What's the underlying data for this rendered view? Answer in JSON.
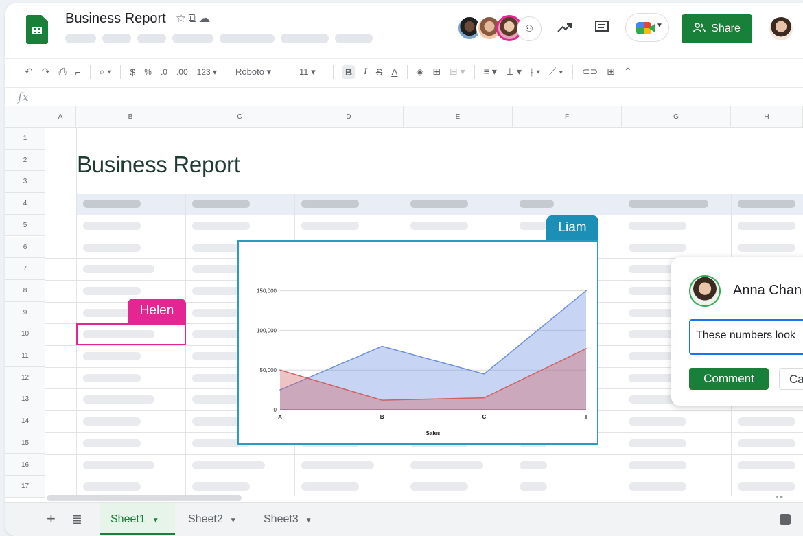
{
  "header": {
    "doc_title": "Business Report",
    "title_icons": [
      "star-icon",
      "move-to-folder-icon",
      "cloud-status-icon"
    ],
    "share_label": "Share",
    "collaborator_avatars": [
      "collaborator-avatar-1",
      "collaborator-avatar-2",
      "collaborator-avatar-3"
    ],
    "more_collaborators_icon": "person-chat-icon",
    "icons": [
      "activity-trend-icon",
      "comment-history-icon",
      "meet-icon",
      "user-avatar"
    ]
  },
  "toolbar": {
    "percent": "%",
    "currency": "$",
    "decimal_decrease": ".0",
    "decimal_increase": ".00",
    "number_format": "123",
    "font": "Roboto",
    "font_size": "11",
    "bold": "B",
    "italic": "I",
    "strike": "S",
    "text_color": "A"
  },
  "formula_bar": {
    "fx_label": "fx"
  },
  "grid": {
    "columns": [
      "A",
      "B",
      "C",
      "D",
      "E",
      "F",
      "G",
      "H"
    ],
    "rows": [
      "1",
      "2",
      "3",
      "4",
      "5",
      "6",
      "7",
      "8",
      "9",
      "10",
      "11",
      "12",
      "13",
      "14",
      "15",
      "16",
      "17"
    ],
    "title_text": "Business Report"
  },
  "cursors": {
    "helen": "Helen",
    "liam": "Liam",
    "helen_color": "#e52592",
    "liam_color": "#1b8fb5"
  },
  "chart_data": {
    "type": "area",
    "categories": [
      "A",
      "B",
      "C",
      "D"
    ],
    "category_tick_labels": [
      "A",
      "B",
      "C",
      "I"
    ],
    "series": [
      {
        "values": [
          25000,
          80000,
          45000,
          150000
        ],
        "color": "#6d8fe0"
      },
      {
        "values": [
          50000,
          12000,
          15000,
          77000
        ],
        "color": "#d16060"
      }
    ],
    "y_ticks": [
      "0",
      "50,000",
      "100,000",
      "150,000"
    ],
    "ylim": [
      0,
      160000
    ],
    "xlabel": "Sales",
    "title": "",
    "ylabel": "",
    "grid": true
  },
  "comment": {
    "author": "Anna Chan",
    "draft_text": "These numbers look",
    "comment_label": "Comment",
    "cancel_label": "Cancel"
  },
  "sheets": {
    "tabs": [
      "Sheet1",
      "Sheet2",
      "Sheet3"
    ],
    "active": "Sheet1",
    "add_icon": "plus-icon",
    "list_icon": "all-sheets-icon"
  },
  "colors": {
    "brand_green": "#188038",
    "header_band": "#e8edf6",
    "selection_blue": "#1a73e8"
  }
}
